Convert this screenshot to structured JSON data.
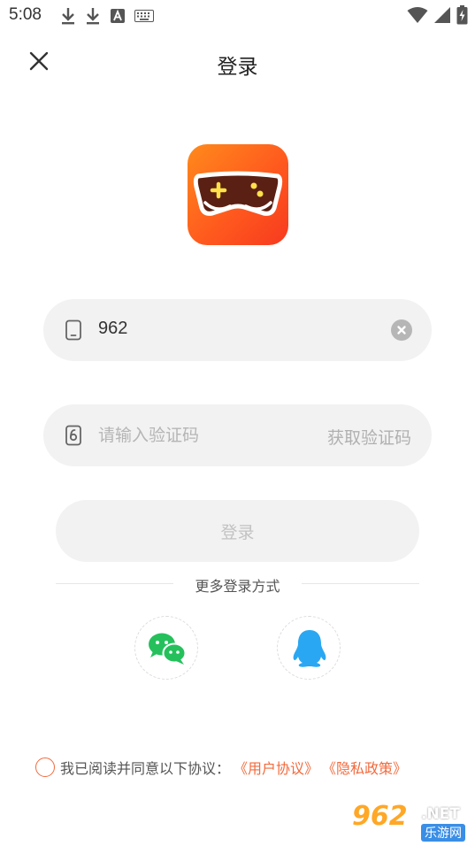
{
  "status_bar": {
    "time": "5:08",
    "icons_left": [
      "download-icon",
      "download-icon",
      "font-a-icon",
      "keyboard-icon"
    ],
    "icons_right": [
      "wifi-icon",
      "signal-icon",
      "battery-charging-icon"
    ]
  },
  "header": {
    "title": "登录",
    "close_icon": "close-icon"
  },
  "colors": {
    "logo_gradient_start": "#ff8a1c",
    "logo_gradient_end": "#f73a1f",
    "accent": "#f26a3c",
    "field_bg": "#f2f2f2",
    "wechat": "#25c05c",
    "qq": "#2aa7f2"
  },
  "form": {
    "phone": {
      "icon": "phone-icon",
      "value": "962",
      "clear_icon": "clear-icon"
    },
    "code": {
      "icon": "lock-icon",
      "placeholder": "请输入验证码",
      "get_code_label": "获取验证码"
    },
    "login_label": "登录"
  },
  "more_login": {
    "label": "更多登录方式",
    "options": [
      {
        "name": "wechat",
        "icon": "wechat-icon"
      },
      {
        "name": "qq",
        "icon": "qq-icon"
      }
    ]
  },
  "agreement": {
    "text": "我已阅读并同意以下协议：",
    "user_agreement": "《用户协议》",
    "privacy_policy": "《隐私政策》"
  },
  "watermark": {
    "number": "962",
    "domain": ".NET",
    "site_name": "乐游网"
  }
}
